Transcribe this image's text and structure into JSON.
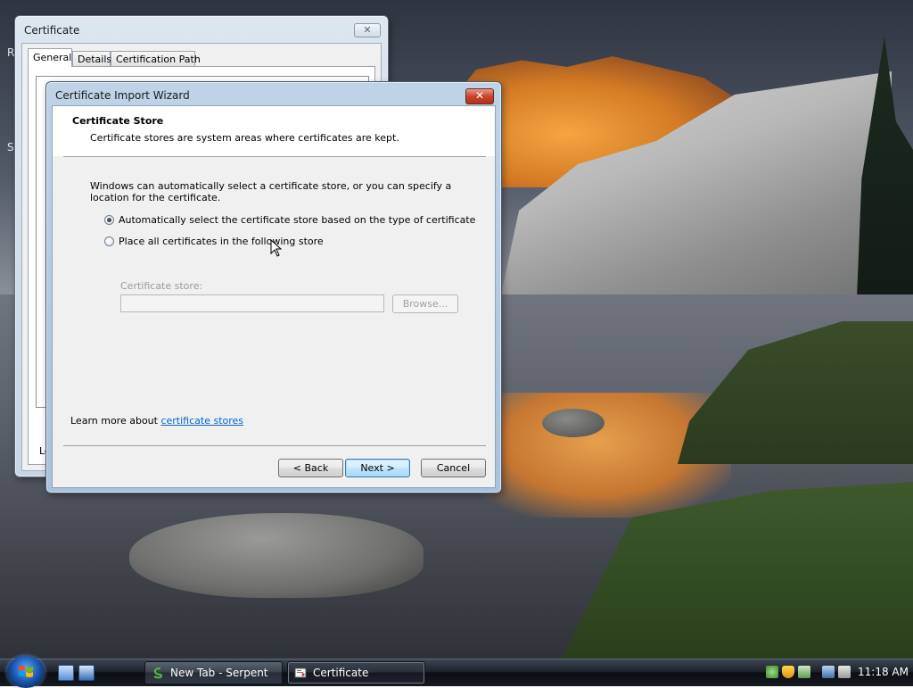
{
  "cert_window": {
    "title": "Certificate",
    "close_glyph": "✕",
    "tabs": [
      {
        "label": "General",
        "active": true
      },
      {
        "label": "Details",
        "active": false
      },
      {
        "label": "Certification Path",
        "active": false
      }
    ],
    "peek_text": "Le"
  },
  "desktop_peek": {
    "r": "R",
    "s": "S"
  },
  "wizard": {
    "title": "Certificate Import Wizard",
    "close_glyph": "✕",
    "header_title": "Certificate Store",
    "header_subtitle": "Certificate stores are system areas where certificates are kept.",
    "intro": "Windows can automatically select a certificate store, or you can specify a location for the certificate.",
    "options": [
      {
        "label": "Automatically select the certificate store based on the type of certificate",
        "selected": true
      },
      {
        "label": "Place all certificates in the following store",
        "selected": false
      }
    ],
    "store_label": "Certificate store:",
    "store_value": "",
    "browse_label": "Browse...",
    "learn_prefix": "Learn more about ",
    "learn_link": "certificate stores",
    "back_label": "< Back",
    "next_label": "Next >",
    "cancel_label": "Cancel"
  },
  "taskbar": {
    "tasks": [
      {
        "label": "New Tab - Serpent",
        "icon": "serpent-browser-icon",
        "active": false
      },
      {
        "label": "Certificate",
        "icon": "certificate-icon",
        "active": true
      }
    ],
    "quick_launch": [
      "show-desktop-icon",
      "switch-windows-icon"
    ],
    "tray_icons": [
      "network-sync-icon",
      "security-shield-icon",
      "safely-remove-icon",
      "network-icon",
      "volume-muted-icon"
    ],
    "clock": "11:18 AM"
  },
  "colors": {
    "link": "#0066cc",
    "default_button_border": "#3c7fb1",
    "close_red": "#c9442c"
  }
}
